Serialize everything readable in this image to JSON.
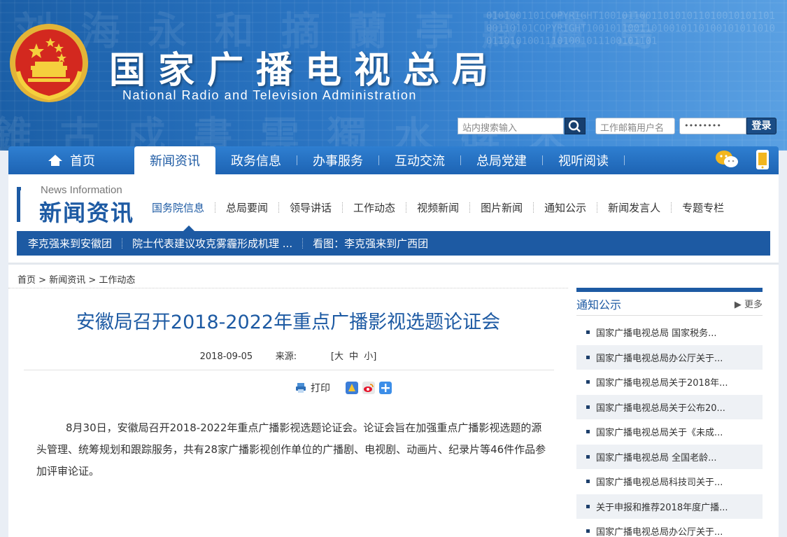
{
  "header": {
    "title_cn": "国家广播电视总局",
    "title_en": "National Radio and Television Administration",
    "search_placeholder": "站内搜索输入",
    "mail_user_placeholder": "工作邮箱用户名",
    "mail_pass_value": "••••••••",
    "login_label": "登录"
  },
  "mainnav": {
    "items": [
      {
        "label": "首页"
      },
      {
        "label": "新闻资讯"
      },
      {
        "label": "政务信息"
      },
      {
        "label": "办事服务"
      },
      {
        "label": "互动交流"
      },
      {
        "label": "总局党建"
      },
      {
        "label": "视听阅读"
      }
    ],
    "active": "新闻资讯"
  },
  "section": {
    "en": "News Information",
    "cn": "新闻资讯",
    "subnav": [
      "国务院信息",
      "总局要闻",
      "领导讲话",
      "工作动态",
      "视频新闻",
      "图片新闻",
      "通知公示",
      "新闻发言人",
      "专题专栏"
    ],
    "ticker": [
      "李克强来到安徽团",
      "院士代表建议攻克雾霾形成机理 ...",
      "看图：李克强来到广西团"
    ]
  },
  "breadcrumb": {
    "home": "首页",
    "sep": ">",
    "level1": "新闻资讯",
    "level2": "工作动态"
  },
  "article": {
    "title": "安徽局召开2018-2022年重点广播影视选题论证会",
    "date": "2018-09-05",
    "source_label": "来源:",
    "font_size_label": "[大 中 小]",
    "print_label": "打印",
    "body": "8月30日，安徽局召开2018-2022年重点广播影视选题论证会。论证会旨在加强重点广播影视选题的源头管理、统筹规划和跟踪服务，共有28家广播影视创作单位的广播剧、电视剧、动画片、纪录片等46件作品参加评审论证。"
  },
  "sidebar": {
    "title": "通知公示",
    "more": "▶ 更多",
    "items": [
      "国家广播电视总局 国家税务...",
      "国家广播电视总局办公厅关于...",
      "国家广播电视总局关于2018年...",
      "国家广播电视总局关于公布20...",
      "国家广播电视总局关于《未成...",
      "国家广播电视总局 全国老龄...",
      "国家广播电视总局科技司关于...",
      "关于申报和推荐2018年度广播...",
      "国家广播电视总局办公厅关于..."
    ]
  }
}
